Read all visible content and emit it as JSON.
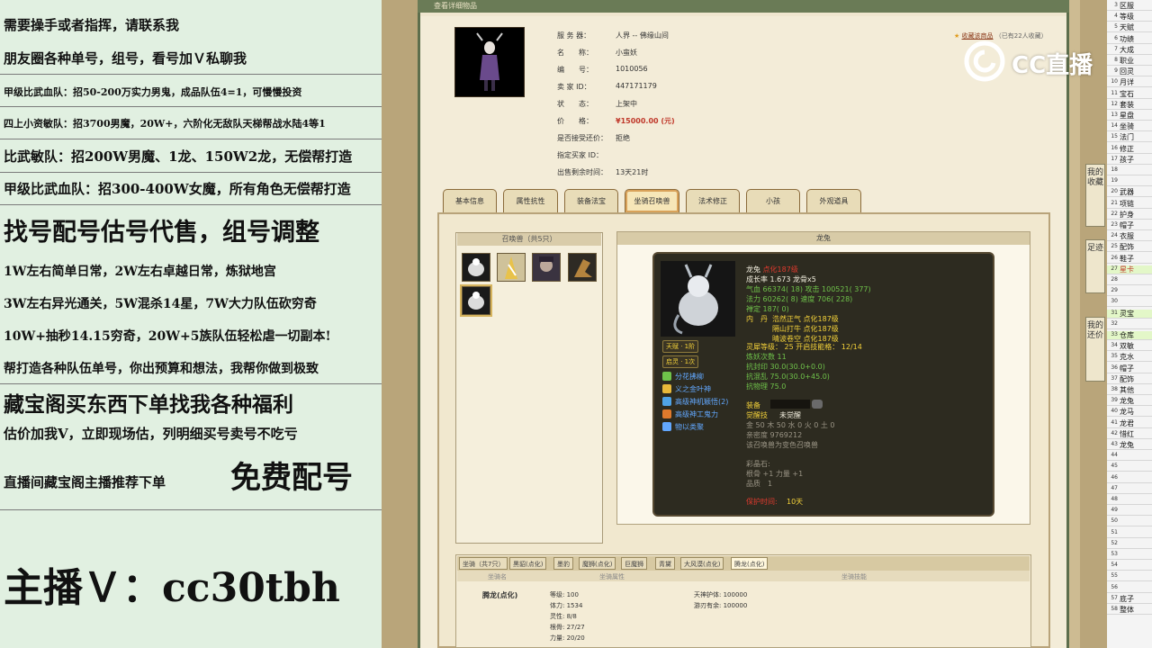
{
  "left_panel": {
    "lines": [
      "需要操手或者指挥，请联系我",
      "朋友圈各种单号，组号，看号加Ｖ私聊我",
      "甲级比武血队：招50-200万实力男鬼，成品队伍4=1，可慢慢投资",
      "四上小资敏队：招3700男魔，20W+，六阶化无敌队天梯帮战水陆4等1",
      "比武敏队：招200W男魔、1龙、150W2龙，无偿帮打造",
      "甲级比武血队：招300-400W女魔，所有角色无偿帮打造",
      "找号配号估号代售，组号调整",
      "1W左右简单日常，2W左右卓越日常，炼狱地宫",
      "3W左右异光通关，5W混杀14星，7W大力队伍砍穷奇",
      "10W+抽秒14.15穷奇，20W+5族队伍轻松虐一切副本!",
      "帮打造各种队伍单号，你出预算和想法，我帮你做到极致",
      "藏宝阁买东西下单找我各种福利",
      "估价加我V，立即现场估，列明细买号卖号不吃亏",
      "直播间藏宝阁主播推荐下单",
      "免费配号",
      "主播Ｖ：cc30tbh"
    ]
  },
  "window": {
    "title": "查看详细物品",
    "fav_link": "收藏该商品",
    "fav_count": "（已有22人收藏）"
  },
  "item_info": [
    {
      "key": "服 务 器：",
      "value": "人界 -- 佛缘山间"
    },
    {
      "key": "名　　称：",
      "value": "小蛮妖"
    },
    {
      "key": "编　　号：",
      "value": "1010056"
    },
    {
      "key": "卖 家 ID：",
      "value": "447171179"
    },
    {
      "key": "状　　态：",
      "value": "上架中"
    },
    {
      "key": "价　　格：",
      "value": "¥15000.00 (元)"
    },
    {
      "key": "是否接受还价：",
      "value": "拒绝"
    },
    {
      "key": "指定买家 ID：",
      "value": ""
    },
    {
      "key": "出售剩余时间：",
      "value": "13天21时"
    }
  ],
  "tabs": [
    "基本信息",
    "属性抗性",
    "装备法宝",
    "坐骑召唤兽",
    "法术修正",
    "小孩",
    "外观道具"
  ],
  "active_tab": "坐骑召唤兽",
  "summon_panel": {
    "title": "召唤兽（共5只）"
  },
  "pet_panel": {
    "title": "龙兔"
  },
  "pet": {
    "name": "龙兔",
    "name_suffix": "点化187级",
    "growth": "成长率 1.673 龙骨x5",
    "hp": "气血 66374( 18) 攻击 100521( 377)",
    "mp": "法力 60262( 8) 速度 706( 228)",
    "zen": "禅定 187( 0)",
    "neidan_label": "内　丹",
    "neidan": [
      "浩然正气 点化187级",
      "隔山打牛 点化187级",
      "晴波卷空 点化187级"
    ],
    "badge1": "天赋 · 1阶",
    "badge2": "启灵 · 1次",
    "skills": [
      "分花拂柳",
      "义之金叶神",
      "高级神机颖悟(2)",
      "高级神工鬼力",
      "物以类聚"
    ],
    "skill_colors": [
      "#6fc24a",
      "#e8b93a",
      "#4fa3e6",
      "#e07a2c",
      "#62a8ff"
    ],
    "spirit": "灵犀等级： 25 开启技能格： 12/14",
    "demon": "炼妖次数 11",
    "resist1": "抗封印 30.0(30.0+0.0)",
    "resist2": "抗混乱 75.0(30.0+45.0)",
    "resist3": "抗物理 75.0",
    "equip_label": "装备",
    "awake_label": "觉醒技",
    "awake_value": "未觉醒",
    "elements": "金 50 木 50 水 0 火 0 土 0",
    "owner": "亲密度 9769212",
    "note": "该召唤兽为变色召唤兽",
    "gem_label": "彩晶石:",
    "bones": "根骨 +1 力量 +1",
    "quality": "品质　1",
    "remain_label": "保护时间:",
    "remain_value": "10天"
  },
  "mount": {
    "tabs": [
      "坐骑（共7只）",
      "黑貂(点化)",
      "墨豹",
      "魔狮(点化)",
      "巨魔狮",
      "青黛",
      "大风漠(点化)",
      "腾龙(点化)"
    ],
    "cols": [
      "坐骑名",
      "坐骑属性",
      "坐骑技能"
    ],
    "name": "腾龙(点化)",
    "stats": [
      "等级: 100",
      "体力: 1534",
      "灵性: 8/8",
      "根骨: 27/27",
      "力量: 20/20"
    ],
    "skills": [
      "天神护体: 100000",
      "游刃有余: 100000"
    ]
  },
  "side_buttons": [
    "我的收藏",
    "足迹",
    "我的还价"
  ],
  "sheet_rows": [
    {
      "n": "3",
      "t": "区服"
    },
    {
      "n": "4",
      "t": "等级"
    },
    {
      "n": "5",
      "t": "天赋"
    },
    {
      "n": "6",
      "t": "功绩"
    },
    {
      "n": "7",
      "t": "大成"
    },
    {
      "n": "8",
      "t": "职业"
    },
    {
      "n": "9",
      "t": "回灵"
    },
    {
      "n": "10",
      "t": "月详"
    },
    {
      "n": "11",
      "t": "宝石"
    },
    {
      "n": "12",
      "t": "套装"
    },
    {
      "n": "13",
      "t": "星盘"
    },
    {
      "n": "14",
      "t": "坐骑"
    },
    {
      "n": "15",
      "t": "法门"
    },
    {
      "n": "16",
      "t": "修正"
    },
    {
      "n": "17",
      "t": "孩子"
    },
    {
      "n": "18",
      "t": ""
    },
    {
      "n": "19",
      "t": ""
    },
    {
      "n": "20",
      "t": "武器"
    },
    {
      "n": "21",
      "t": "项链"
    },
    {
      "n": "22",
      "t": "护身"
    },
    {
      "n": "23",
      "t": "帽子"
    },
    {
      "n": "24",
      "t": "衣服"
    },
    {
      "n": "25",
      "t": "配饰"
    },
    {
      "n": "26",
      "t": "鞋子"
    },
    {
      "n": "27",
      "t": "星卡"
    },
    {
      "n": "28",
      "t": ""
    },
    {
      "n": "29",
      "t": ""
    },
    {
      "n": "30",
      "t": ""
    },
    {
      "n": "31",
      "t": "灵宝"
    },
    {
      "n": "32",
      "t": ""
    },
    {
      "n": "33",
      "t": "仓库"
    },
    {
      "n": "34",
      "t": "双敏"
    },
    {
      "n": "35",
      "t": "克水"
    },
    {
      "n": "36",
      "t": "帽子"
    },
    {
      "n": "37",
      "t": "配饰"
    },
    {
      "n": "38",
      "t": "其他"
    },
    {
      "n": "39",
      "t": "龙兔"
    },
    {
      "n": "40",
      "t": "龙马"
    },
    {
      "n": "41",
      "t": "龙君"
    },
    {
      "n": "42",
      "t": "惜红"
    },
    {
      "n": "43",
      "t": "龙兔"
    },
    {
      "n": "44",
      "t": ""
    },
    {
      "n": "45",
      "t": ""
    },
    {
      "n": "46",
      "t": ""
    },
    {
      "n": "47",
      "t": ""
    },
    {
      "n": "48",
      "t": ""
    },
    {
      "n": "49",
      "t": ""
    },
    {
      "n": "50",
      "t": ""
    },
    {
      "n": "51",
      "t": ""
    },
    {
      "n": "52",
      "t": ""
    },
    {
      "n": "53",
      "t": ""
    },
    {
      "n": "54",
      "t": ""
    },
    {
      "n": "55",
      "t": ""
    },
    {
      "n": "56",
      "t": ""
    },
    {
      "n": "57",
      "t": "底子"
    },
    {
      "n": "58",
      "t": "整体"
    }
  ],
  "watermark": "CC直播"
}
